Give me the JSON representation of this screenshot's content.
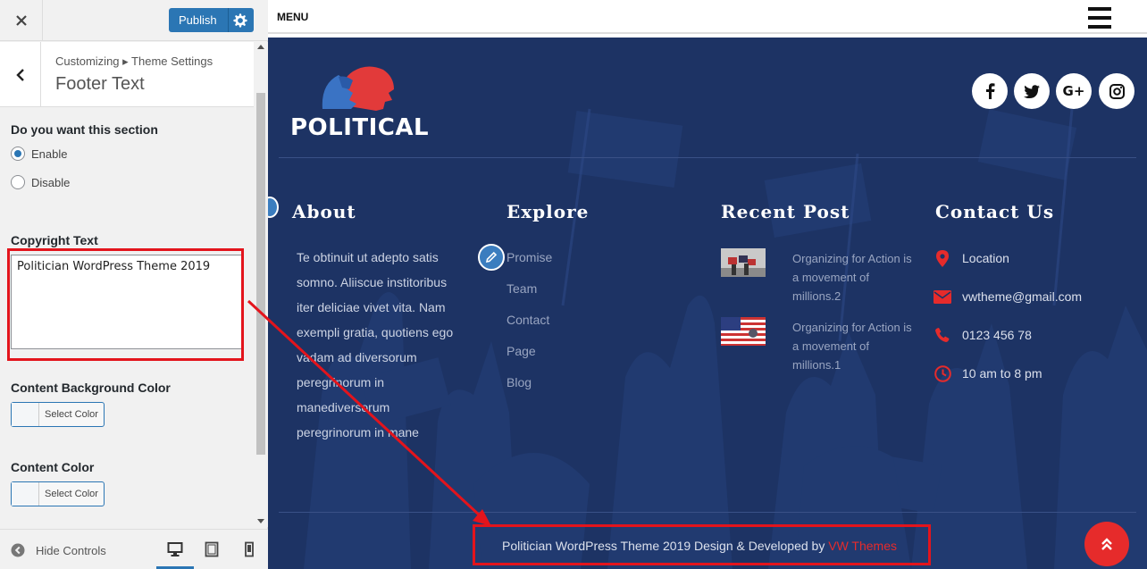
{
  "customizer": {
    "publish_label": "Publish",
    "breadcrumb": "Customizing ▸ Theme Settings",
    "section_title": "Footer Text",
    "section_question": "Do you want this section",
    "radio_enable": "Enable",
    "radio_disable": "Disable",
    "copyright_label": "Copyright Text",
    "copyright_value": "Politician WordPress Theme 2019",
    "content_bg_label": "Content Background Color",
    "content_color_label": "Content Color",
    "select_color": "Select Color",
    "hide_controls": "Hide Controls",
    "accent_color": "#2b76b4"
  },
  "preview": {
    "menu_label": "MENU",
    "logo_text": "POLITICAL",
    "social": [
      {
        "icon": "facebook-icon",
        "glyph": "f"
      },
      {
        "icon": "twitter-icon",
        "glyph": "t"
      },
      {
        "icon": "google-plus-icon",
        "glyph": "G+"
      },
      {
        "icon": "instagram-icon",
        "glyph": "ig"
      }
    ],
    "about": {
      "title": "About",
      "text": "Te obtinuit ut adepto satis somno. Aliiscue institoribus iter deliciae vivet vita. Nam exempli gratia, quotiens ego vadam ad diversorum peregrinorum in manediversorum peregrinorum in mane"
    },
    "explore": {
      "title": "Explore",
      "links": [
        "Promise",
        "Team",
        "Contact",
        "Page",
        "Blog"
      ]
    },
    "recent_post": {
      "title": "Recent Post",
      "posts": [
        {
          "title": "Organizing for Action is a movement of millions.2"
        },
        {
          "title": "Organizing for Action is a movement of millions.1"
        }
      ]
    },
    "contact": {
      "title": "Contact Us",
      "location": "Location",
      "email": "vwtheme@gmail.com",
      "phone": "0123 456 78",
      "hours": "10 am to 8 pm"
    },
    "credit_text": "Politician WordPress Theme 2019 Design & Developed by ",
    "credit_brand": "VW Themes",
    "footer_bg_color": "#1d3364",
    "brand_red": "#e62b2b"
  }
}
